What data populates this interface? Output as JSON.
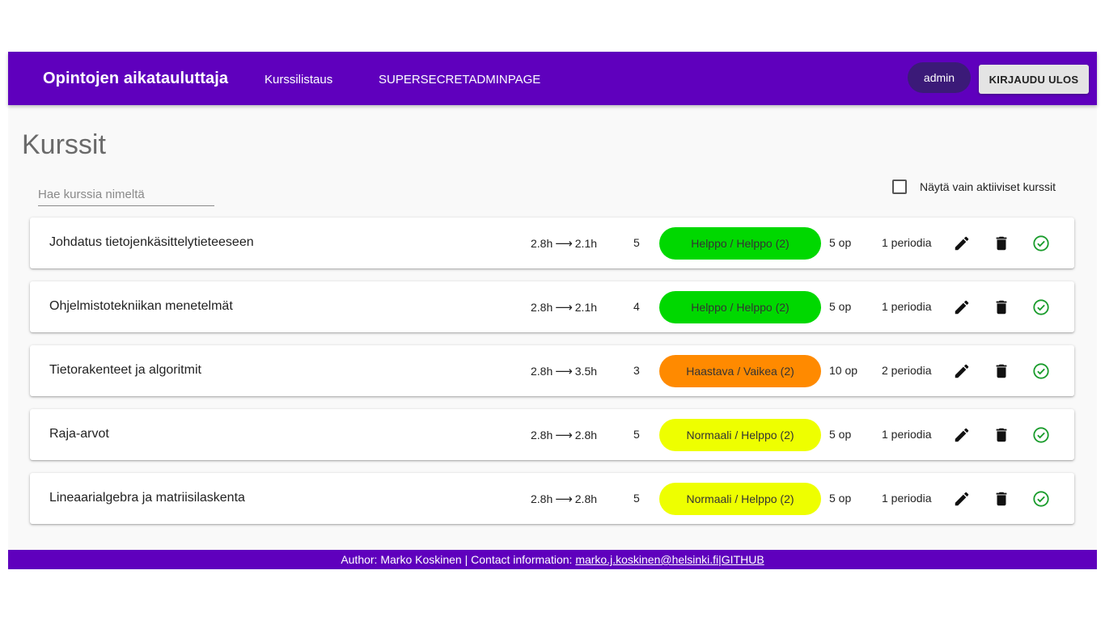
{
  "header": {
    "brand": "Opintojen aikatauluttaja",
    "nav": [
      "Kurssilistaus",
      "SUPERSECRETADMINPAGE"
    ],
    "user": "admin",
    "logout_label": "KIRJAUDU ULOS"
  },
  "main": {
    "title": "Kurssit",
    "search_placeholder": "Hae kurssia nimeltä",
    "filter_label": "Näytä vain aktiiviset kurssit",
    "filter_checked": false
  },
  "courses": [
    {
      "name": "Johdatus tietojenkäsittelytieteeseen",
      "hours_from": "2.8h",
      "hours_to": "2.1h",
      "rating": "5",
      "difficulty": "Helppo / Helppo (2)",
      "difficulty_color": "#00d800",
      "credits": "5 op",
      "periods": "1 periodia"
    },
    {
      "name": "Ohjelmistotekniikan menetelmät",
      "hours_from": "2.8h",
      "hours_to": "2.1h",
      "rating": "4",
      "difficulty": "Helppo / Helppo (2)",
      "difficulty_color": "#00d800",
      "credits": "5 op",
      "periods": "1 periodia"
    },
    {
      "name": "Tietorakenteet ja algoritmit",
      "hours_from": "2.8h",
      "hours_to": "3.5h",
      "rating": "3",
      "difficulty": "Haastava / Vaikea (2)",
      "difficulty_color": "#ff8a00",
      "credits": "10 op",
      "periods": "2 periodia"
    },
    {
      "name": "Raja-arvot",
      "hours_from": "2.8h",
      "hours_to": "2.8h",
      "rating": "5",
      "difficulty": "Normaali / Helppo (2)",
      "difficulty_color": "#eeff00",
      "credits": "5 op",
      "periods": "1 periodia"
    },
    {
      "name": "Lineaarialgebra ja matriisilaskenta",
      "hours_from": "2.8h",
      "hours_to": "2.8h",
      "rating": "5",
      "difficulty": "Normaali / Helppo (2)",
      "difficulty_color": "#eeff00",
      "credits": "5 op",
      "periods": "1 periodia"
    }
  ],
  "row_icons": [
    "pencil-icon",
    "trash-icon",
    "check-circle-icon"
  ],
  "footer": {
    "prefix": "Author: Marko Koskinen | Contact information: ",
    "email": "marko.j.koskinen@helsinki.fi",
    "separator": " | ",
    "github": "GITHUB"
  },
  "colors": {
    "primary": "#5f00bd",
    "user_chip": "#3b1a78",
    "check_icon": "#1a9c2c"
  }
}
